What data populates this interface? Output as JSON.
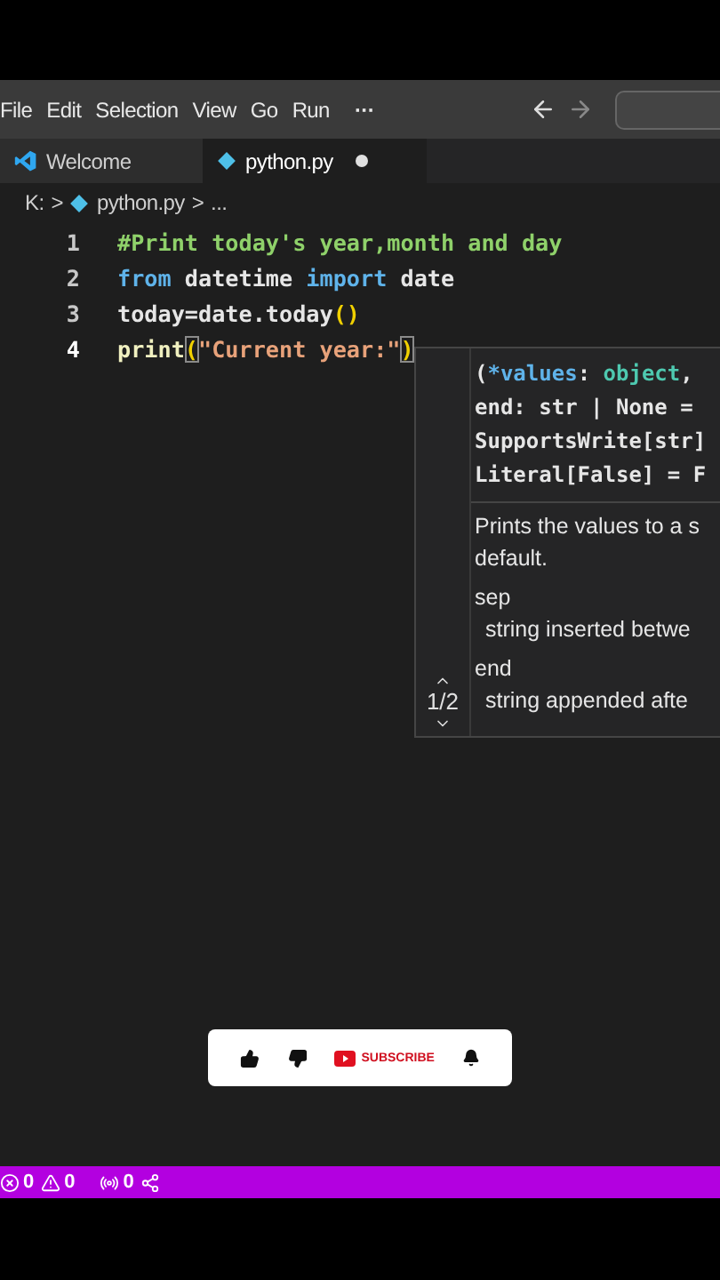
{
  "menu": [
    "File",
    "Edit",
    "Selection",
    "View",
    "Go",
    "Run",
    "···"
  ],
  "tabs": [
    {
      "label": "Welcome",
      "kind": "welcome",
      "selected": false,
      "modified": false
    },
    {
      "label": "python.py",
      "kind": "python",
      "selected": true,
      "modified": true
    }
  ],
  "breadcrumb": [
    "K:",
    ">",
    "python.py",
    ">",
    "..."
  ],
  "code": [
    {
      "number": "1",
      "active": false,
      "tokens": [
        {
          "kind": "comment",
          "text": "#Print today's year,month and day"
        }
      ]
    },
    {
      "number": "2",
      "active": false,
      "tokens": [
        {
          "kind": "keyword",
          "text": "from"
        },
        {
          "kind": "plain",
          "text": " datetime "
        },
        {
          "kind": "keyword",
          "text": "import"
        },
        {
          "kind": "plain",
          "text": " date"
        }
      ]
    },
    {
      "number": "3",
      "active": false,
      "tokens": [
        {
          "kind": "plain",
          "text": "today=date.today"
        },
        {
          "kind": "paren",
          "text": "()"
        }
      ]
    },
    {
      "number": "4",
      "active": true,
      "tokens": [
        {
          "kind": "function",
          "text": "print"
        },
        {
          "kind": "bracket",
          "text": "("
        },
        {
          "kind": "string",
          "text": "\"Current year:\""
        },
        {
          "kind": "bracket",
          "text": ")"
        }
      ]
    }
  ],
  "hover": {
    "signature": [
      [
        {
          "kind": "plain",
          "text": "("
        },
        {
          "kind": "param",
          "text": "*values"
        },
        {
          "kind": "plain",
          "text": ": "
        },
        {
          "kind": "type",
          "text": "object"
        },
        {
          "kind": "plain",
          "text": ","
        }
      ],
      [
        {
          "kind": "plain",
          "text": "end: str | None ="
        }
      ],
      [
        {
          "kind": "plain",
          "text": "SupportsWrite[str]"
        }
      ],
      [
        {
          "kind": "plain",
          "text": "Literal[False] = F"
        }
      ]
    ],
    "doc": [
      {
        "kind": "text",
        "text": "Prints the values to a s"
      },
      {
        "kind": "text",
        "text": "default."
      },
      {
        "kind": "term",
        "text": "sep"
      },
      {
        "kind": "desc",
        "text": "string inserted betwe"
      },
      {
        "kind": "term",
        "text": "end"
      },
      {
        "kind": "desc",
        "text": "string appended afte"
      }
    ],
    "counter": "1/2"
  },
  "overlay": {
    "subscribe": "SUBSCRIBE"
  },
  "status": [
    {
      "kind": "errors",
      "text": "0"
    },
    {
      "kind": "warnings",
      "text": "0"
    },
    {
      "kind": "ports",
      "text": "0"
    },
    {
      "kind": "share"
    }
  ]
}
